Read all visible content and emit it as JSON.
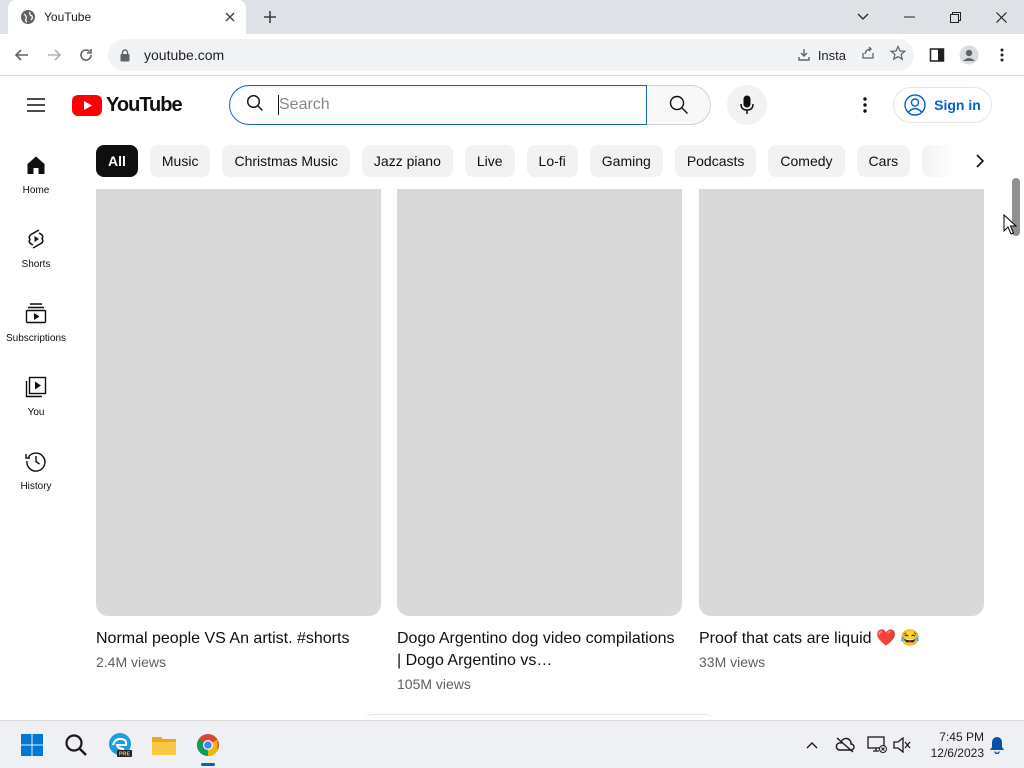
{
  "browser": {
    "tab_title": "YouTube",
    "url": "youtube.com",
    "install_label": "Insta"
  },
  "masthead": {
    "logo_text": "YouTube",
    "search_placeholder": "Search",
    "search_value": "",
    "signin_label": "Sign in"
  },
  "guide": {
    "items": [
      {
        "label": "Home",
        "icon": "home-icon"
      },
      {
        "label": "Shorts",
        "icon": "shorts-icon"
      },
      {
        "label": "Subscriptions",
        "icon": "subscriptions-icon"
      },
      {
        "label": "You",
        "icon": "you-icon"
      },
      {
        "label": "History",
        "icon": "history-icon"
      }
    ]
  },
  "chips": [
    "All",
    "Music",
    "Christmas Music",
    "Jazz piano",
    "Live",
    "Lo-fi",
    "Gaming",
    "Podcasts",
    "Comedy",
    "Cars"
  ],
  "videos": [
    {
      "title": "Normal people VS An artist. #shorts",
      "views": "2.4M views"
    },
    {
      "title": "Dogo Argentino dog video compilations | Dogo Argentino vs…",
      "views": "105M views"
    },
    {
      "title": "Proof that cats are liquid ❤️ 😂",
      "views": "33M views"
    }
  ],
  "taskbar": {
    "time": "7:45 PM",
    "date": "12/6/2023"
  },
  "colors": {
    "brand_red": "#ff0000",
    "link_blue": "#065fd4",
    "thumb_placeholder": "#d9d9d9"
  }
}
